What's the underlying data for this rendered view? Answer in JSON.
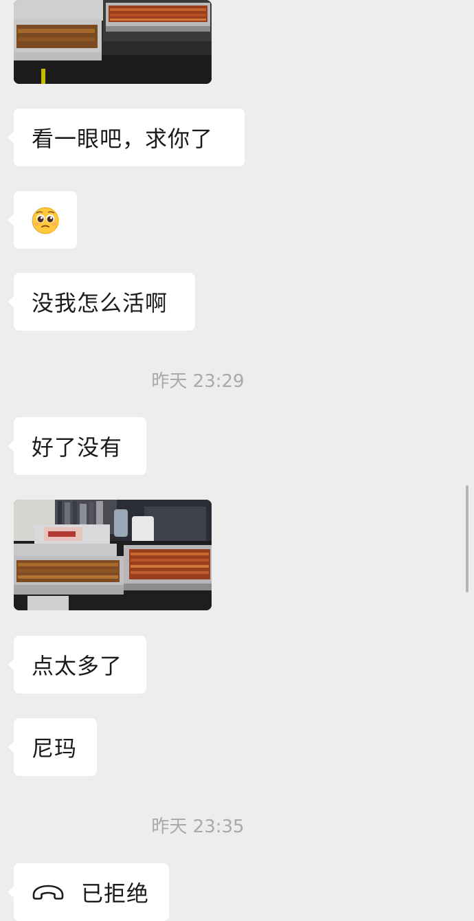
{
  "messages": {
    "m1": {
      "text": "看一眼吧，求你了"
    },
    "m2": {
      "emoji": "pleading-face-emoji"
    },
    "m3": {
      "text": "没我怎么活啊"
    },
    "t1": {
      "text": "昨天 23:29"
    },
    "m4": {
      "text": "好了没有"
    },
    "m5": {
      "image": "food-photo"
    },
    "m6": {
      "text": "点太多了"
    },
    "m7": {
      "text": "尼玛"
    },
    "t2": {
      "text": "昨天 23:35"
    },
    "m8": {
      "icon": "hangup-phone-icon",
      "text": "已拒绝"
    }
  },
  "colors": {
    "background": "#ededed",
    "bubble": "#ffffff",
    "timestamp": "#a9a9a9",
    "text": "#1a1a1a"
  }
}
